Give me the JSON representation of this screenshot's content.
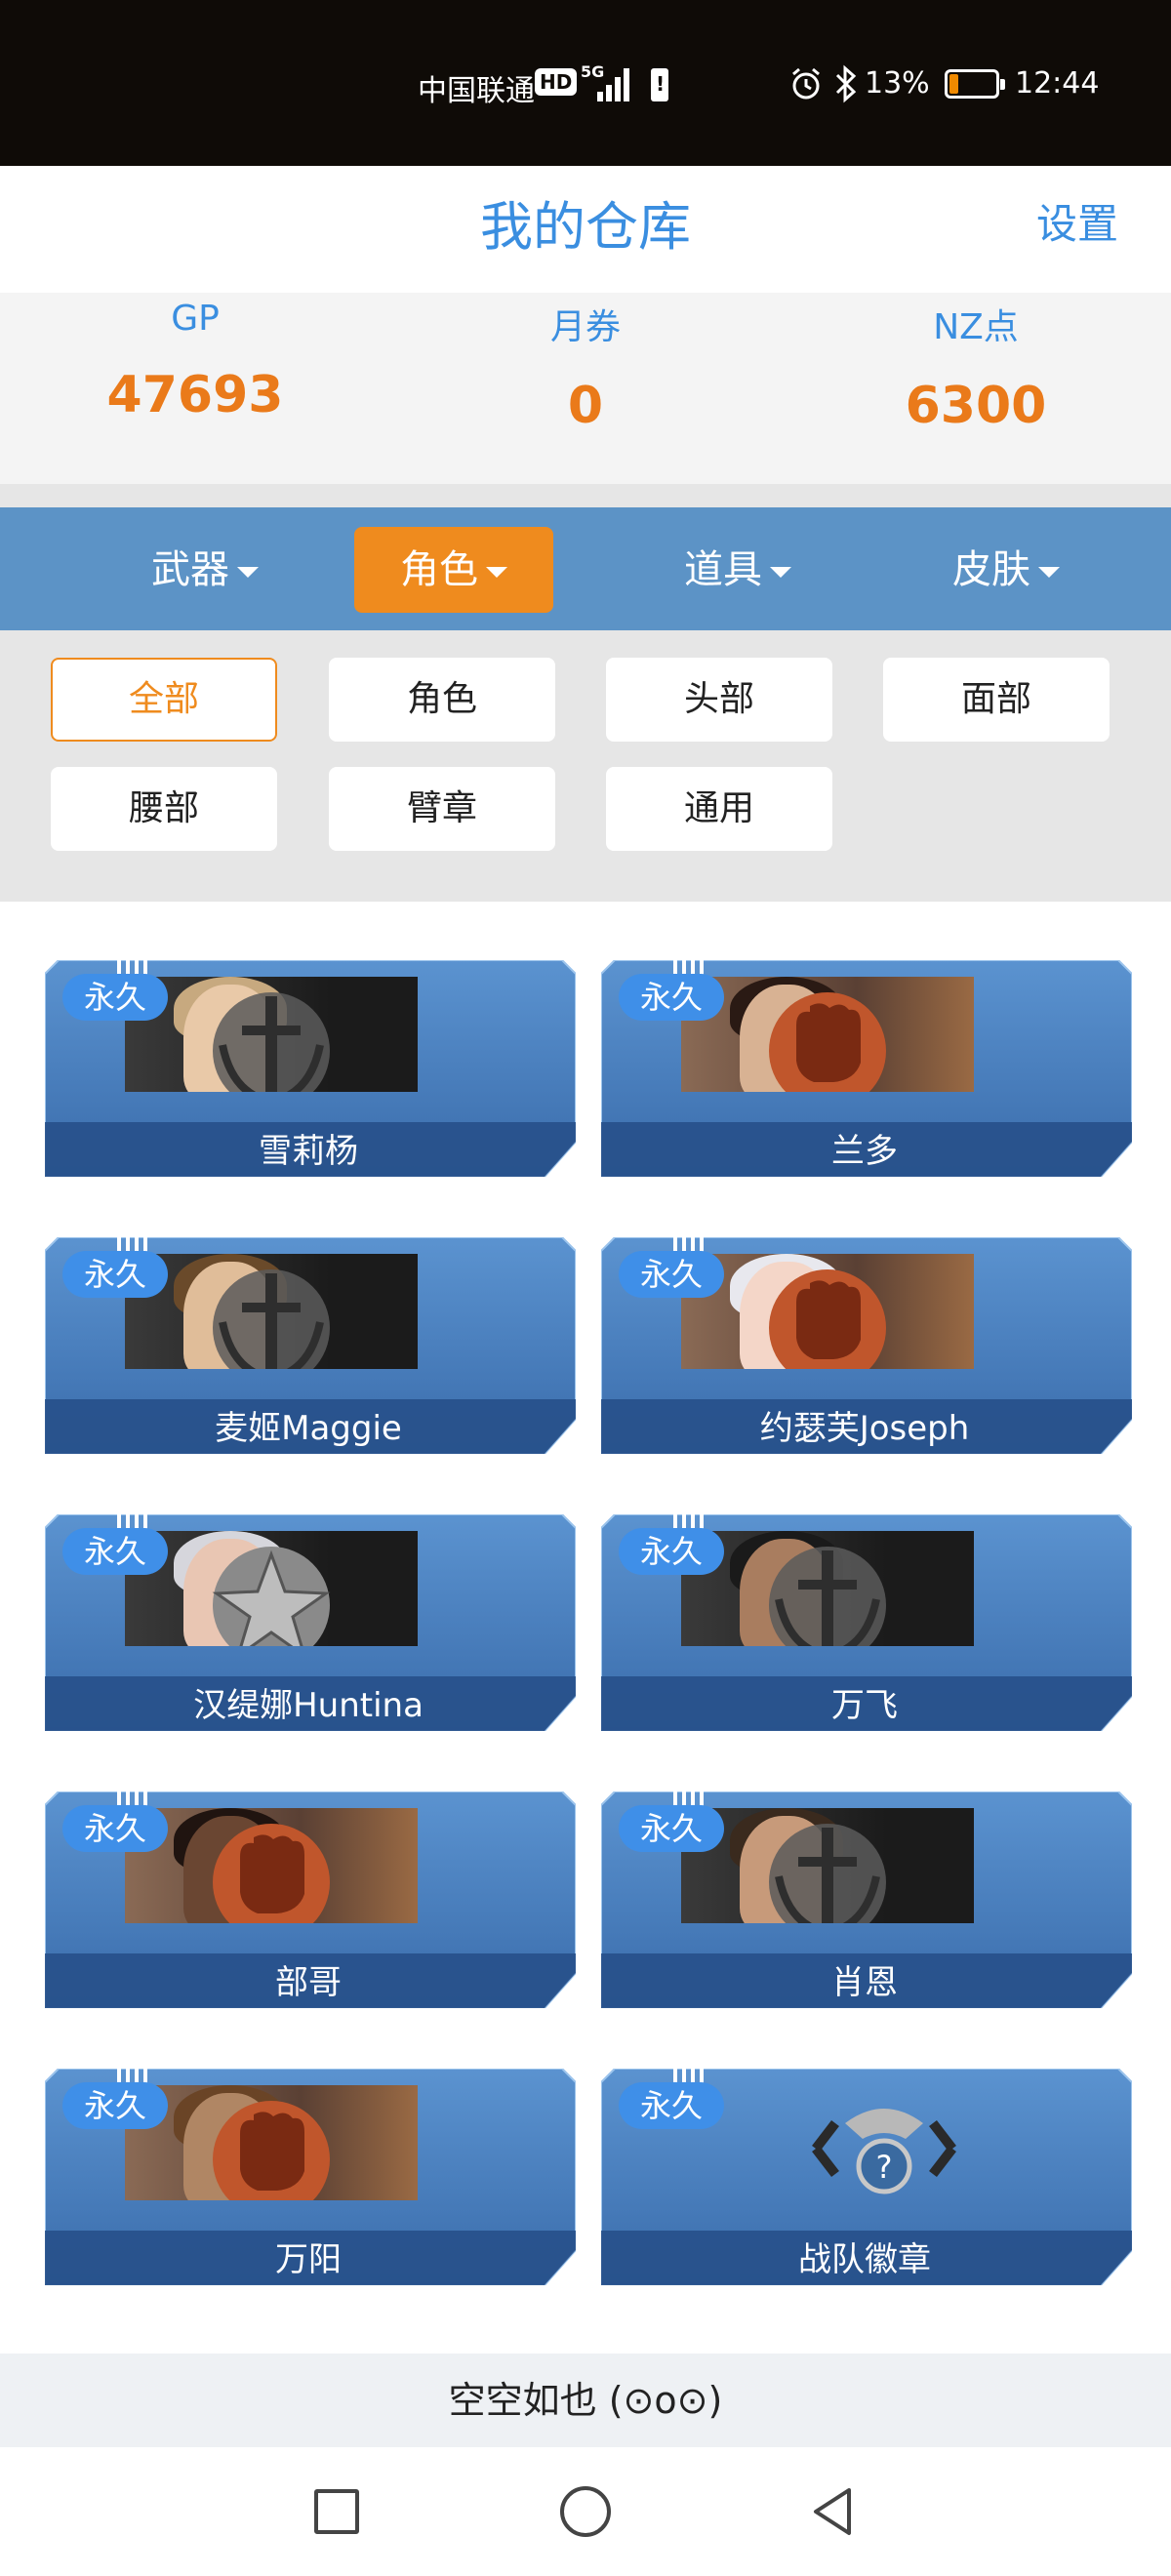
{
  "status_bar": {
    "carrier": "中国联通",
    "hd_badge": "HD",
    "network": "5G",
    "battery_percent": "13%",
    "battery_level": 0.13,
    "time": "12:44",
    "icons": [
      "signal-icon",
      "sim-alert-icon",
      "alarm-icon",
      "bluetooth-icon",
      "battery-icon"
    ]
  },
  "header": {
    "title": "我的仓库",
    "settings_label": "设置",
    "back_icon": "chevron-left-icon"
  },
  "currencies": [
    {
      "label": "GP",
      "value": "47693"
    },
    {
      "label": "月券",
      "value": "0"
    },
    {
      "label": "NZ点",
      "value": "6300"
    }
  ],
  "categories": [
    {
      "label": "武器",
      "active": false
    },
    {
      "label": "角色",
      "active": true
    },
    {
      "label": "道具",
      "active": false
    },
    {
      "label": "皮肤",
      "active": false
    }
  ],
  "filters": [
    {
      "label": "全部",
      "active": true
    },
    {
      "label": "角色",
      "active": false
    },
    {
      "label": "头部",
      "active": false
    },
    {
      "label": "面部",
      "active": false
    },
    {
      "label": "腰部",
      "active": false
    },
    {
      "label": "臂章",
      "active": false
    },
    {
      "label": "通用",
      "active": false
    }
  ],
  "items": [
    {
      "name": "雪莉杨",
      "badge": "永久",
      "emblem": "sword"
    },
    {
      "name": "兰多",
      "badge": "永久",
      "emblem": "fist"
    },
    {
      "name": "麦姬Maggie",
      "badge": "永久",
      "emblem": "sword"
    },
    {
      "name": "约瑟芙Joseph",
      "badge": "永久",
      "emblem": "fist"
    },
    {
      "name": "汉缇娜Huntina",
      "badge": "永久",
      "emblem": "star"
    },
    {
      "name": "万飞",
      "badge": "永久",
      "emblem": "sword"
    },
    {
      "name": "部哥",
      "badge": "永久",
      "emblem": "fist"
    },
    {
      "name": "肖恩",
      "badge": "永久",
      "emblem": "sword"
    },
    {
      "name": "万阳",
      "badge": "永久",
      "emblem": "fist"
    },
    {
      "name": "战队徽章",
      "badge": "永久",
      "emblem": "eagle"
    }
  ],
  "empty_text": "空空如也 (⊙o⊙)",
  "nav_bar": {
    "icons": [
      "recent-apps-icon",
      "home-icon",
      "back-icon"
    ]
  },
  "colors": {
    "accent_blue": "#3a8ee0",
    "accent_orange": "#ef8b1e",
    "category_bar": "#5c93c6",
    "card_blue": "#4a82c2"
  }
}
